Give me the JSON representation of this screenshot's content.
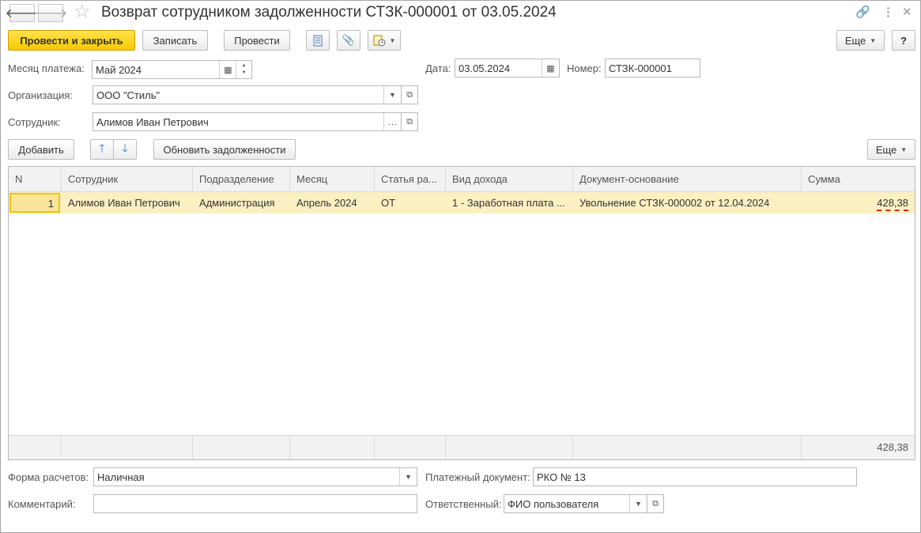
{
  "window": {
    "title": "Возврат сотрудником задолженности СТЗК-000001 от 03.05.2024"
  },
  "toolbar": {
    "post_and_close": "Провести и закрыть",
    "save": "Записать",
    "post": "Провести",
    "more": "Еще",
    "help": "?"
  },
  "form": {
    "pay_month_label": "Месяц платежа:",
    "pay_month_value": "Май 2024",
    "date_label": "Дата:",
    "date_value": "03.05.2024",
    "number_label": "Номер:",
    "number_value": "СТЗК-000001",
    "org_label": "Организация:",
    "org_value": "ООО \"Стиль\"",
    "employee_label": "Сотрудник:",
    "employee_value": "Алимов Иван Петрович"
  },
  "table_toolbar": {
    "add": "Добавить",
    "refresh": "Обновить задолженности",
    "more": "Еще"
  },
  "table": {
    "columns": [
      "N",
      "Сотрудник",
      "Подразделение",
      "Месяц",
      "Статья ра...",
      "Вид дохода",
      "Документ-основание",
      "Сумма"
    ],
    "rows": [
      {
        "n": "1",
        "employee": "Алимов Иван Петрович",
        "department": "Администрация",
        "month": "Апрель 2024",
        "article": "ОТ",
        "income_type": "1 - Заработная плата ...",
        "basis_doc": "Увольнение СТЗК-000002 от 12.04.2024",
        "sum": "428,38"
      }
    ],
    "total": "428,38"
  },
  "footer_form": {
    "payment_form_label": "Форма расчетов:",
    "payment_form_value": "Наличная",
    "payment_doc_label": "Платежный документ:",
    "payment_doc_value": "РКО № 13",
    "comment_label": "Комментарий:",
    "comment_value": "",
    "responsible_label": "Ответственный:",
    "responsible_value": "ФИО пользователя"
  },
  "colors": {
    "primary_button": "#f7c900",
    "selected_row": "#fbf0c2",
    "error_underline": "#e0201b"
  }
}
